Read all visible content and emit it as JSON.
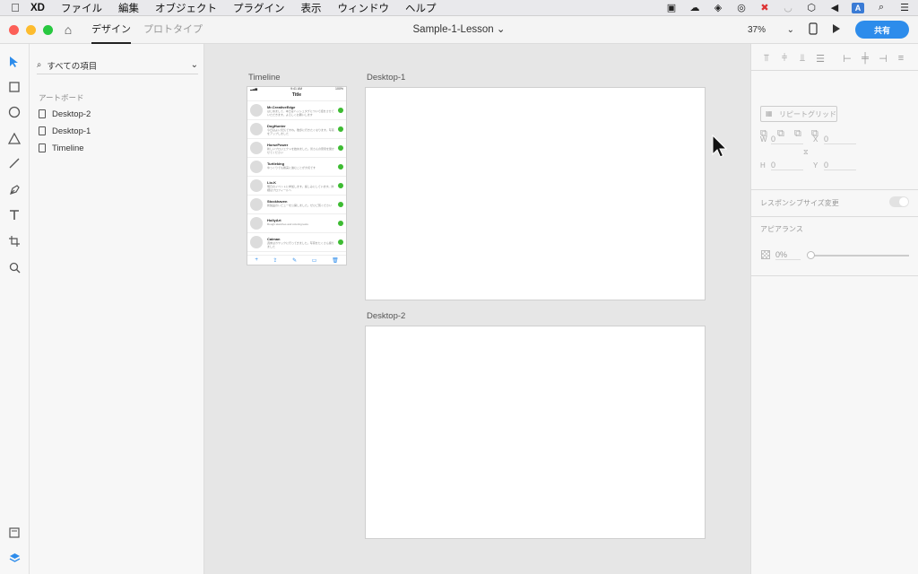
{
  "menubar": {
    "app": "XD",
    "items": [
      "ファイル",
      "編集",
      "オブジェクト",
      "プラグイン",
      "表示",
      "ウィンドウ",
      "ヘルプ"
    ],
    "status_icons": [
      "camera-icon",
      "cloud-icon",
      "dropbox-icon",
      "creative-cloud-icon",
      "x-badge-icon",
      "wifi-icon",
      "shield-icon",
      "volume-icon",
      "input-source-icon",
      "spotlight-icon",
      "list-icon"
    ],
    "input_badge": "A"
  },
  "toolbar": {
    "tabs": [
      "デザイン",
      "プロトタイプ"
    ],
    "doc_title": "Sample-1-Lesson",
    "zoom": "37%",
    "share_label": "共有"
  },
  "layers": {
    "filter_label": "すべての項目",
    "section": "アートボード",
    "items": [
      "Desktop-2",
      "Desktop-1",
      "Timeline"
    ]
  },
  "canvas": {
    "artboards": [
      {
        "label": "Timeline"
      },
      {
        "label": "Desktop-1"
      },
      {
        "label": "Desktop-2"
      }
    ],
    "phone": {
      "time": "9:41 AM",
      "battery": "100%",
      "title": "Title",
      "rows": [
        {
          "name": "Mr.CreativeEdge",
          "msg": "はじめまして、本日はハッシュタグについて話をさせていただきます。よろしくお願いします"
        },
        {
          "name": "DogHunter",
          "msg": "今日はよい天気ですね。散歩に行きたくなります。写真をアップしました"
        },
        {
          "name": "HorsePower",
          "msg": "新しいプロジェクトを始めました。皆さんの意見を聞かせてください"
        },
        {
          "name": "Turtleking",
          "msg": "ゆっくりでも確実に進むことが大切です"
        },
        {
          "name": "Lio.K",
          "msg": "明日のイベントに参加します。楽しみにしています。詳細はプロフィールへ"
        },
        {
          "name": "Stockhaven",
          "msg": "新製品のレビューを公開しました。ぜひご覧ください"
        },
        {
          "name": "HollyArt",
          "msg": "Rough sketches and coloring tests"
        },
        {
          "name": "Caiman",
          "msg": "週末はカヤックに行ってきました。写真をたくさん撮りました"
        }
      ],
      "tabbar": [
        "+",
        "⇪",
        "✎",
        "▭",
        "🗑"
      ]
    }
  },
  "props": {
    "repeat_grid": "リピートグリッド",
    "w_label": "W",
    "w_value": "0",
    "h_label": "H",
    "h_value": "0",
    "x_label": "X",
    "x_value": "0",
    "y_label": "Y",
    "y_value": "0",
    "responsive_label": "レスポンシブサイズ変更",
    "appearance_label": "アピアランス",
    "opacity_value": "0%"
  },
  "colors": {
    "accent": "#2d8ceb",
    "online_dot": "#3dbb32"
  }
}
